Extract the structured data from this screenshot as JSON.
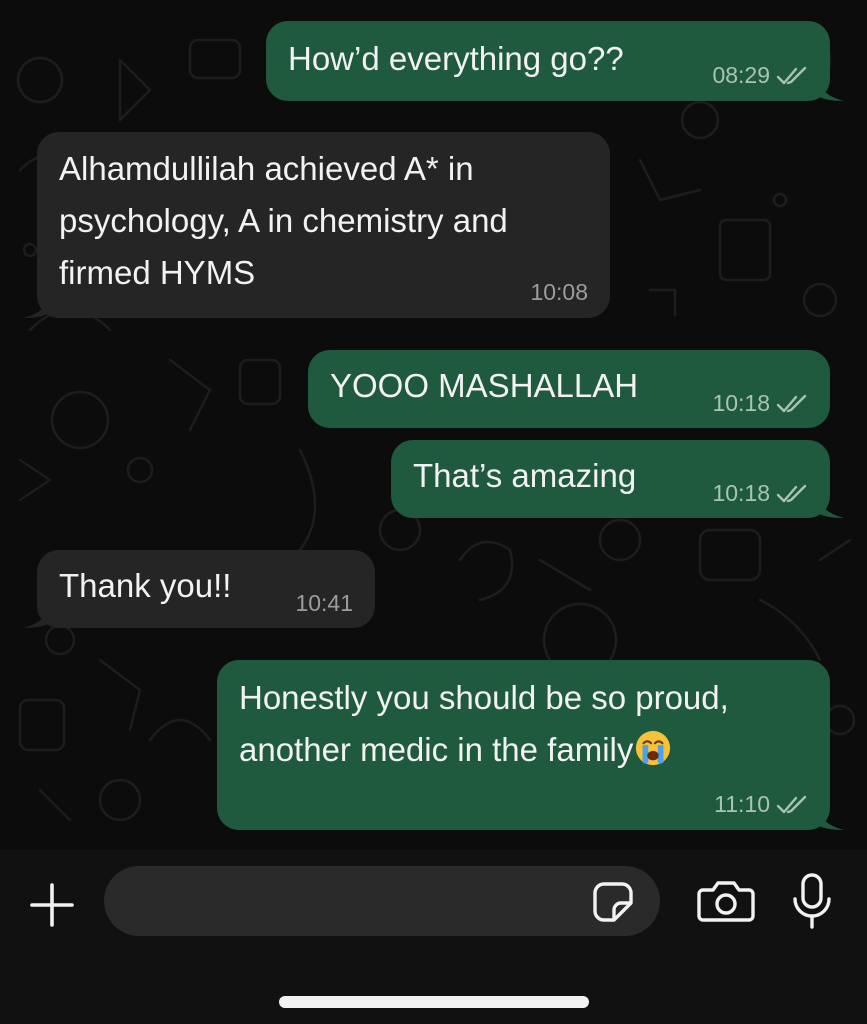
{
  "chat": {
    "messages": [
      {
        "direction": "outgoing",
        "lines": [
          "How’d everything go??"
        ],
        "time": "08:29",
        "status": "read"
      },
      {
        "direction": "incoming",
        "lines": [
          "Alhamdullilah achieved A* in",
          "psychology, A in chemistry and",
          "firmed HYMS"
        ],
        "time": "10:08"
      },
      {
        "direction": "outgoing",
        "lines": [
          "YOOO MASHALLAH"
        ],
        "time": "10:18",
        "status": "read"
      },
      {
        "direction": "outgoing",
        "lines": [
          "That’s amazing"
        ],
        "time": "10:18",
        "status": "read"
      },
      {
        "direction": "incoming",
        "lines": [
          "Thank you!!"
        ],
        "time": "10:41"
      },
      {
        "direction": "outgoing",
        "lines": [
          "Honestly you should be so proud,",
          "another medic in the family"
        ],
        "emoji": "loudly-crying-face",
        "time": "11:10",
        "status": "read"
      }
    ]
  },
  "composer": {
    "input_value": "",
    "icons": {
      "attach": "plus-icon",
      "sticker": "sticker-icon",
      "camera": "camera-icon",
      "mic": "microphone-icon"
    }
  },
  "colors": {
    "outgoing_bubble": "#1f5a3e",
    "incoming_bubble": "#252525",
    "background": "#0c0c0c",
    "read_ticks": "#a9c3b6"
  }
}
